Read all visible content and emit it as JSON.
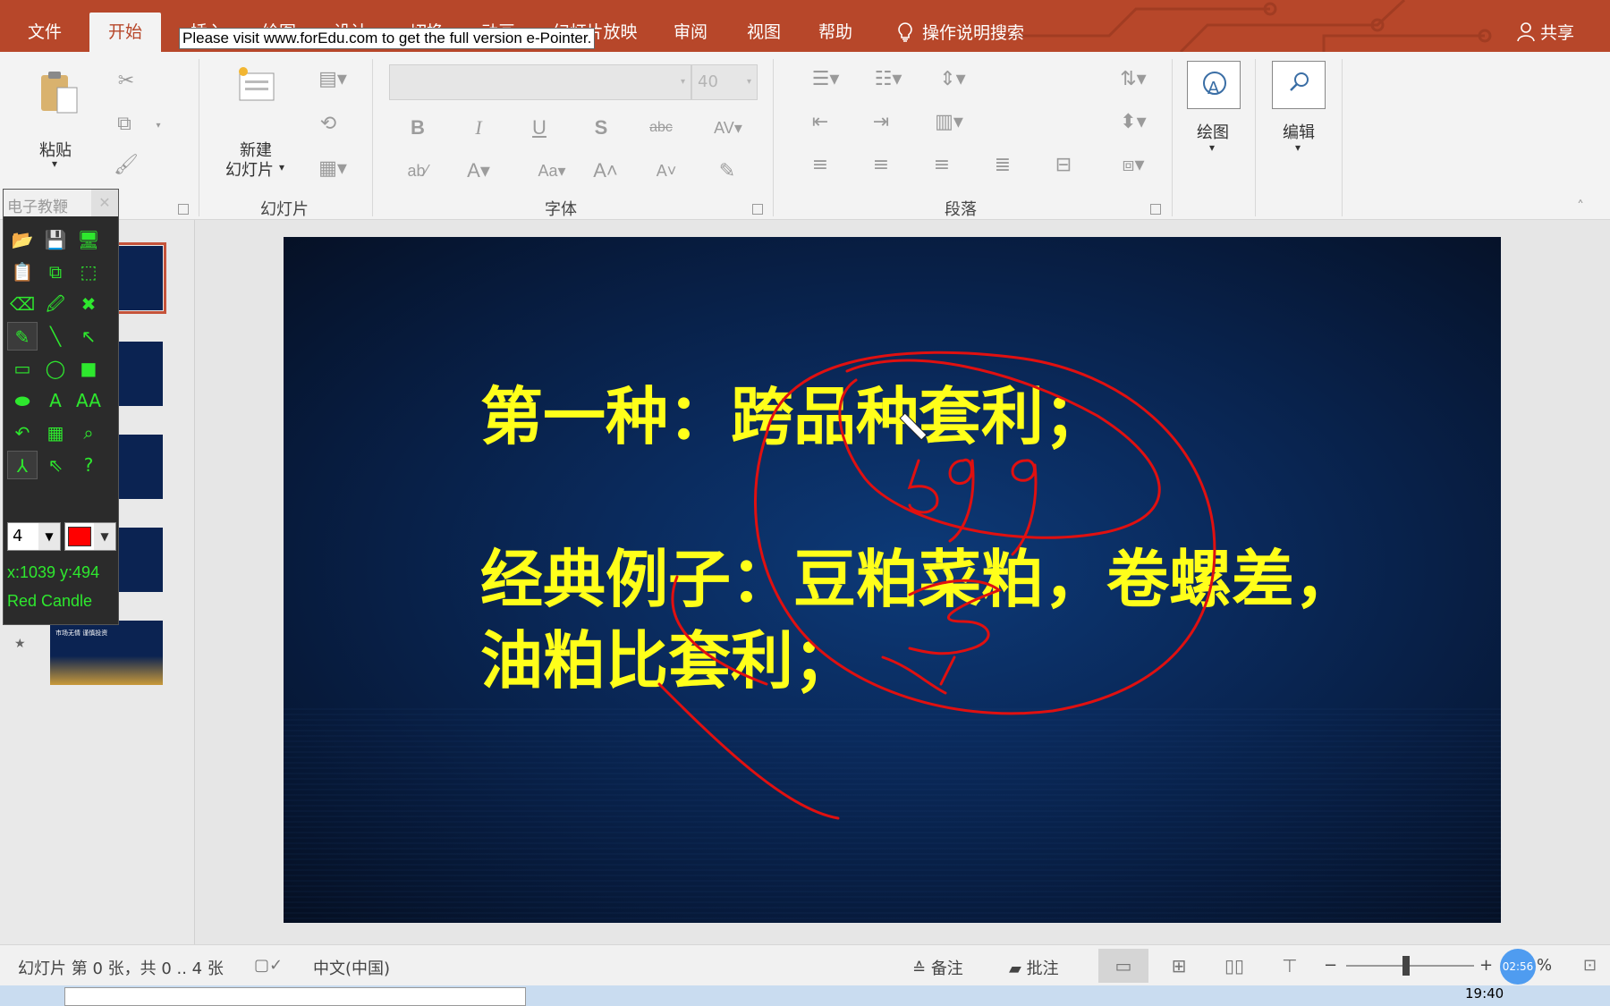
{
  "tabs": [
    "文件",
    "开始",
    "插入",
    "绘图",
    "设计",
    "切换",
    "动画",
    "幻灯片放映",
    "审阅",
    "视图",
    "帮助"
  ],
  "active_tab": "开始",
  "tell_me": "操作说明搜索",
  "share": "共享",
  "watermark": "Please visit www.forEdu.com to get the full version e-Pointer.",
  "ribbon": {
    "paste_label": "粘贴",
    "new_slide_label_1": "新建",
    "new_slide_label_2": "幻灯片",
    "slides_group": "幻灯片",
    "font_group": "字体",
    "paragraph_group": "段落",
    "draw_label": "绘图",
    "edit_label": "编辑",
    "font_size": "40"
  },
  "epointer": {
    "title": "电子教鞭",
    "pen_size": "4",
    "coords": "x:1039 y:494",
    "pen_name": "Red Candle",
    "pen_color": "#ff0000"
  },
  "slide": {
    "line1": "第一种：跨品种套利；",
    "line2": "经典例子：豆粕菜粕，卷螺差，",
    "line3": "油粕比套利；",
    "ink_digits": "599",
    "thumb5_text": "市场无情 谨慎投资"
  },
  "status": {
    "slide_info": "幻灯片 第 0 张，共 0 .. 4 张",
    "language": "中文(中国)",
    "notes": "备注",
    "comments": "批注",
    "timer": "02:56",
    "zoom_suffix": "%"
  },
  "taskbar": {
    "clock": "19:40"
  },
  "colors": {
    "tabbar": "#b7472a",
    "slide_text": "#ffff1a",
    "ink": "#e01010",
    "epointer_green": "#2ee82e"
  }
}
